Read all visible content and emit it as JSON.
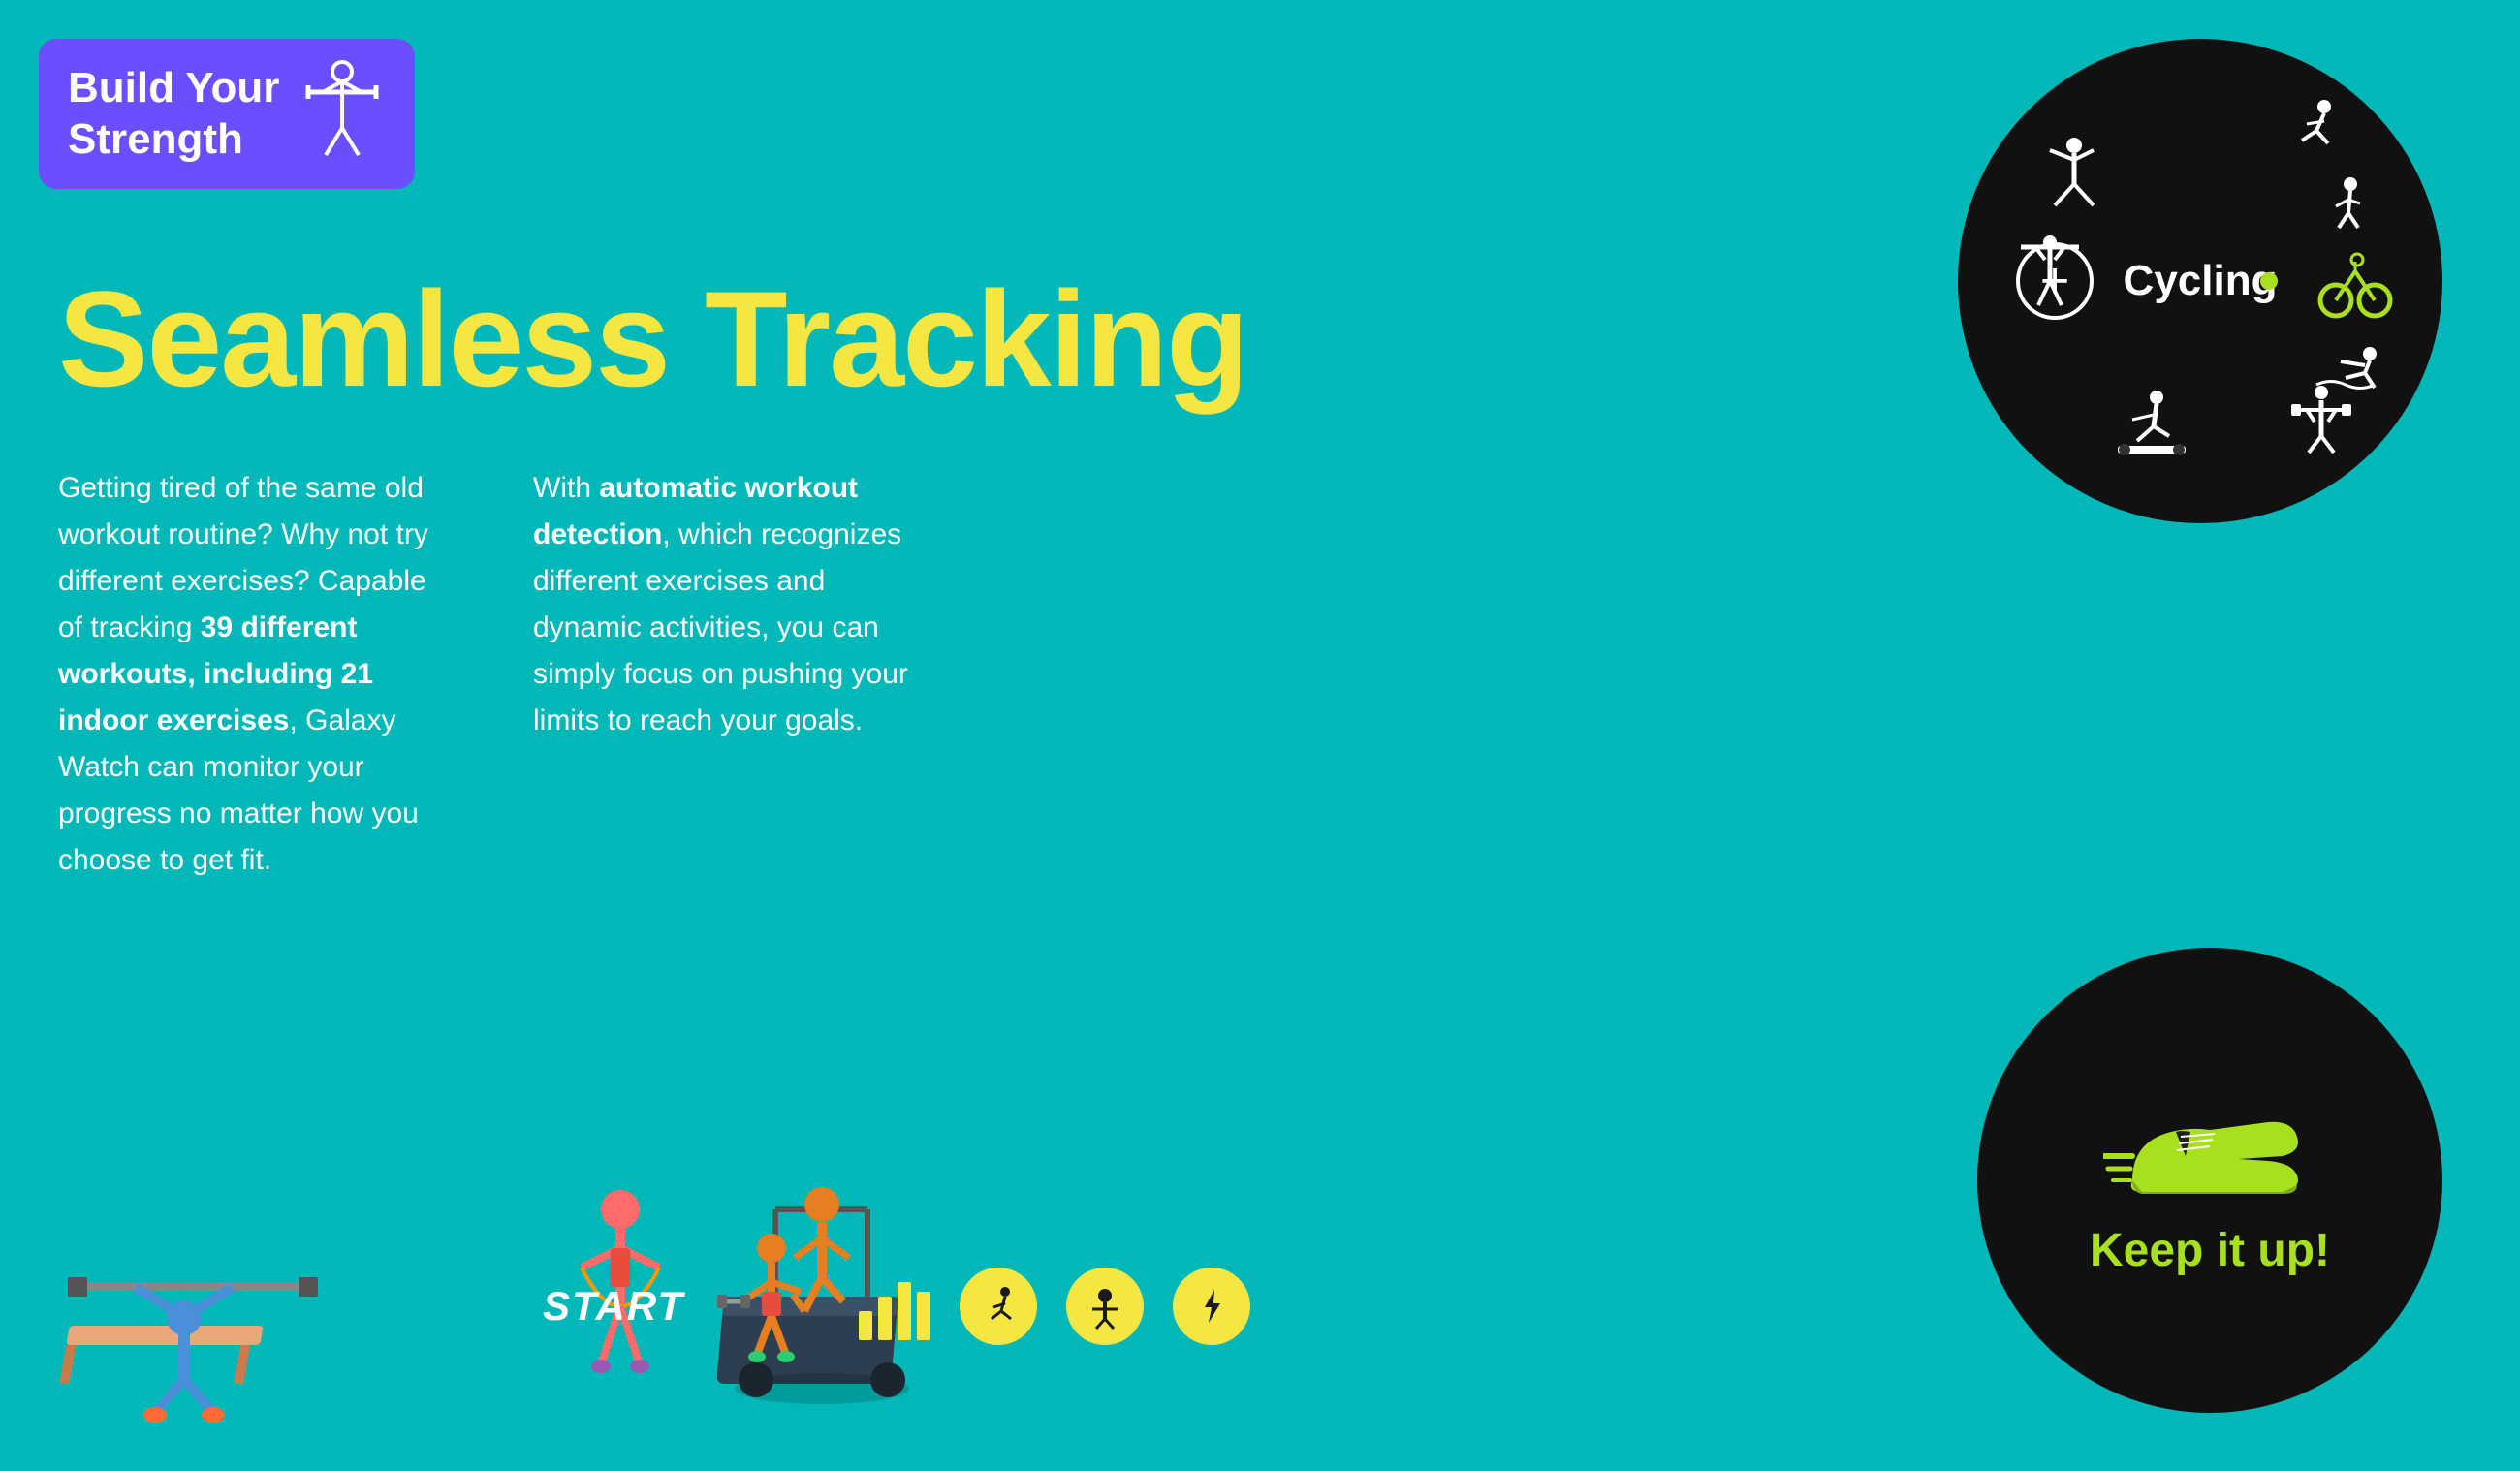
{
  "brand": {
    "title": "Build Your\nStrength",
    "icon": "🏋️"
  },
  "heading": "Seamless Tracking",
  "body": {
    "col1": {
      "text_before": "Getting tired of the same old workout routine? Why not try different exercises? Capable of tracking ",
      "bold1": "39 different workouts, including 21 indoor exercises",
      "text_after": ", Galaxy Watch can monitor your progress no matter how you choose to get fit."
    },
    "col2": {
      "text_before": "With ",
      "bold1": "automatic workout detection",
      "text_after": ", which recognizes different exercises and dynamic activities, you can simply focus on pushing your limits to reach your goals."
    }
  },
  "watch_cycling": {
    "label": "Cycling",
    "add_btn": "+",
    "active_indicator": "●"
  },
  "watch_running": {
    "label": "Keep it up!",
    "shoe_icon": "👟"
  },
  "start_row": {
    "start_label": "START"
  },
  "colors": {
    "bg": "#00B8B8",
    "brand_bg": "#6B4EFF",
    "heading": "#F5E642",
    "text": "#ffffff",
    "watch_bg": "#111111",
    "green_accent": "#A8E020"
  }
}
